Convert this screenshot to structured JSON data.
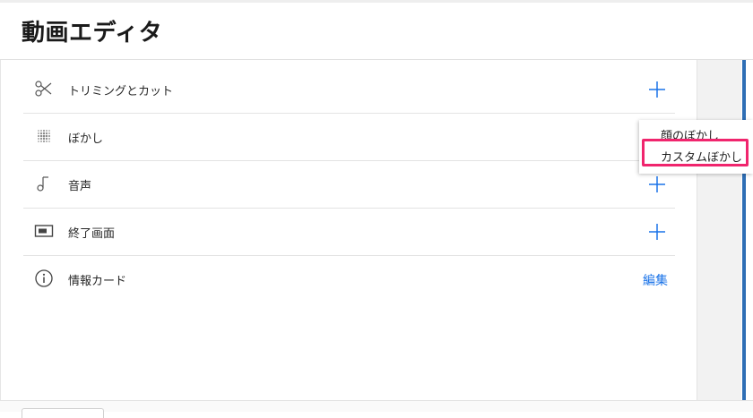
{
  "header": {
    "title": "動画エディタ"
  },
  "rows": [
    {
      "icon": "scissors-icon",
      "label": "トリミングとカット",
      "action": "add"
    },
    {
      "icon": "blur-icon",
      "label": "ぼかし",
      "action": "add"
    },
    {
      "icon": "music-note-icon",
      "label": "音声",
      "action": "add"
    },
    {
      "icon": "end-screen-icon",
      "label": "終了画面",
      "action": "add"
    },
    {
      "icon": "info-icon",
      "label": "情報カード",
      "action": "edit",
      "action_label": "編集"
    }
  ],
  "blur_menu": {
    "items": [
      "顔のぼかし",
      "カスタムぼかし"
    ],
    "highlighted_item": "カスタムぼかし"
  },
  "colors": {
    "accent": "#1a73e8",
    "highlight": "#f0256d",
    "panel_bar": "#2e6eb5"
  }
}
